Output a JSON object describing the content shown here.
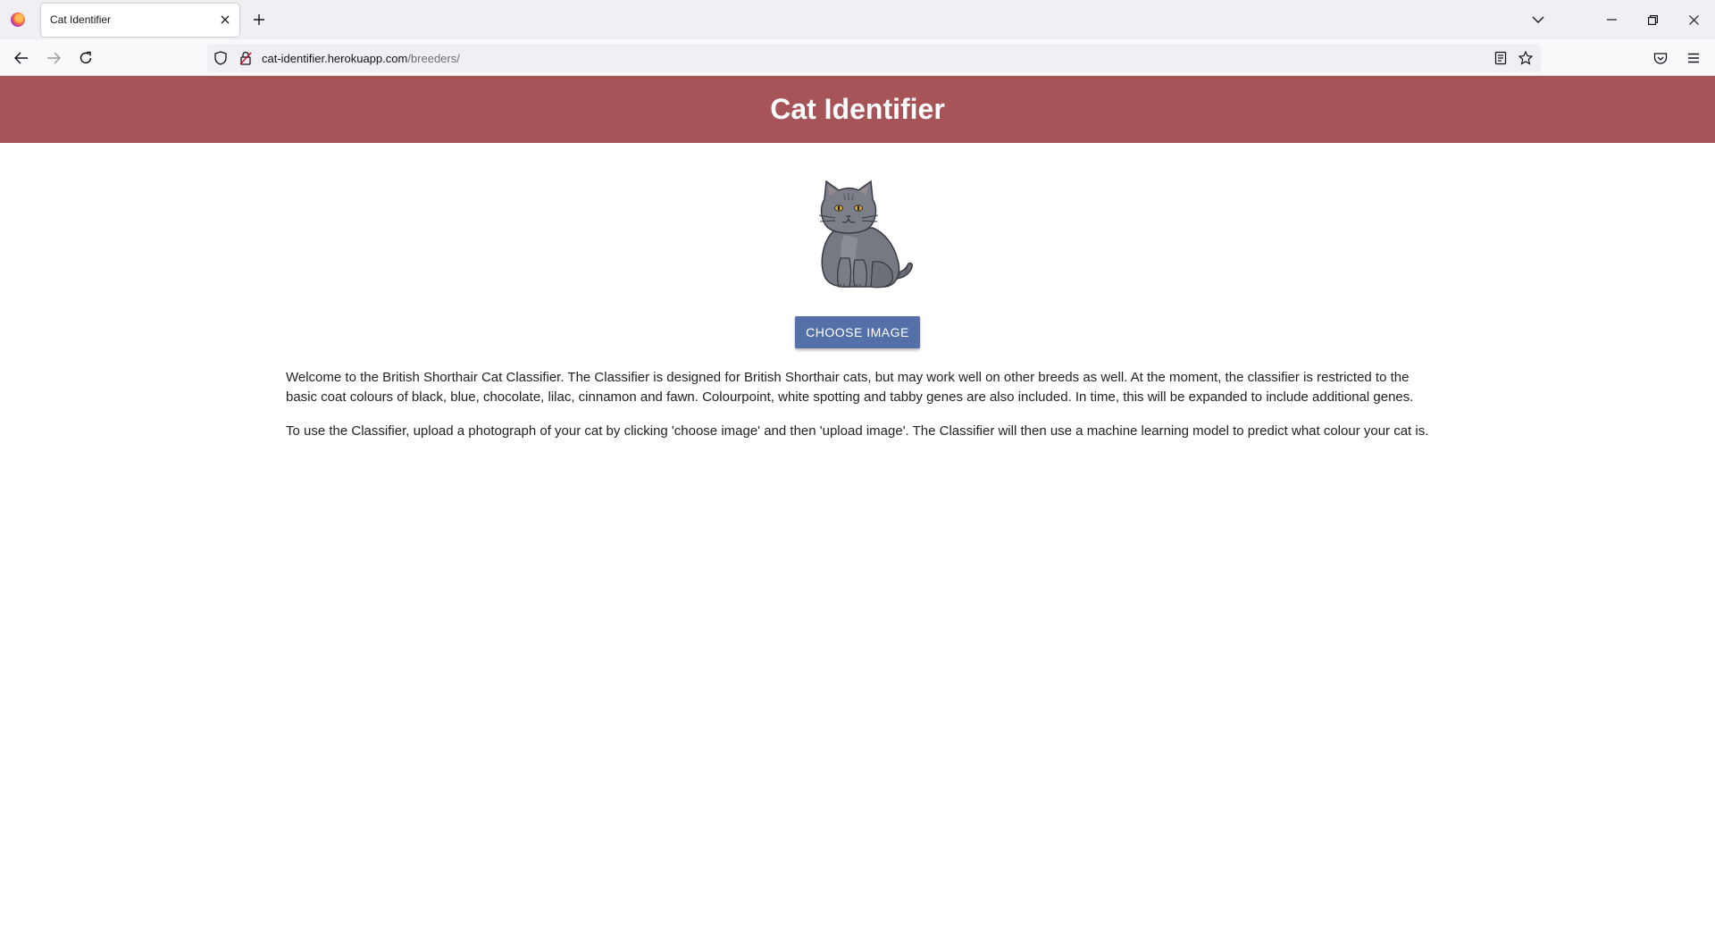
{
  "browser": {
    "tab_title": "Cat Identifier",
    "url_domain": "cat-identifier.herokuapp.com",
    "url_path": "/breeders/",
    "icons": [
      "firefox-logo",
      "close-icon",
      "plus-icon",
      "chevron-down-icon",
      "minimize-icon",
      "restore-icon",
      "close-window-icon",
      "back-arrow-icon",
      "forward-arrow-icon",
      "reload-icon",
      "shield-icon",
      "lock-icon",
      "reader-view-icon",
      "star-icon",
      "pocket-icon",
      "menu-icon"
    ]
  },
  "page": {
    "header_title": "Cat Identifier",
    "header_color": "#a65458",
    "cat_image": "british-shorthair-cat-illustration",
    "choose_button_label": "CHOOSE IMAGE",
    "button_color": "#5470a8",
    "paragraph_1": "Welcome to the British Shorthair Cat Classifier. The Classifier is designed for British Shorthair cats, but may work well on other breeds as well. At the moment, the classifier is restricted to the basic coat colours of black, blue, chocolate, lilac, cinnamon and fawn. Colourpoint, white spotting and tabby genes are also included. In time, this will be expanded to include additional genes.",
    "paragraph_2": "To use the Classifier, upload a photograph of your cat by clicking 'choose image' and then 'upload image'. The Classifier will then use a machine learning model to predict what colour your cat is."
  }
}
